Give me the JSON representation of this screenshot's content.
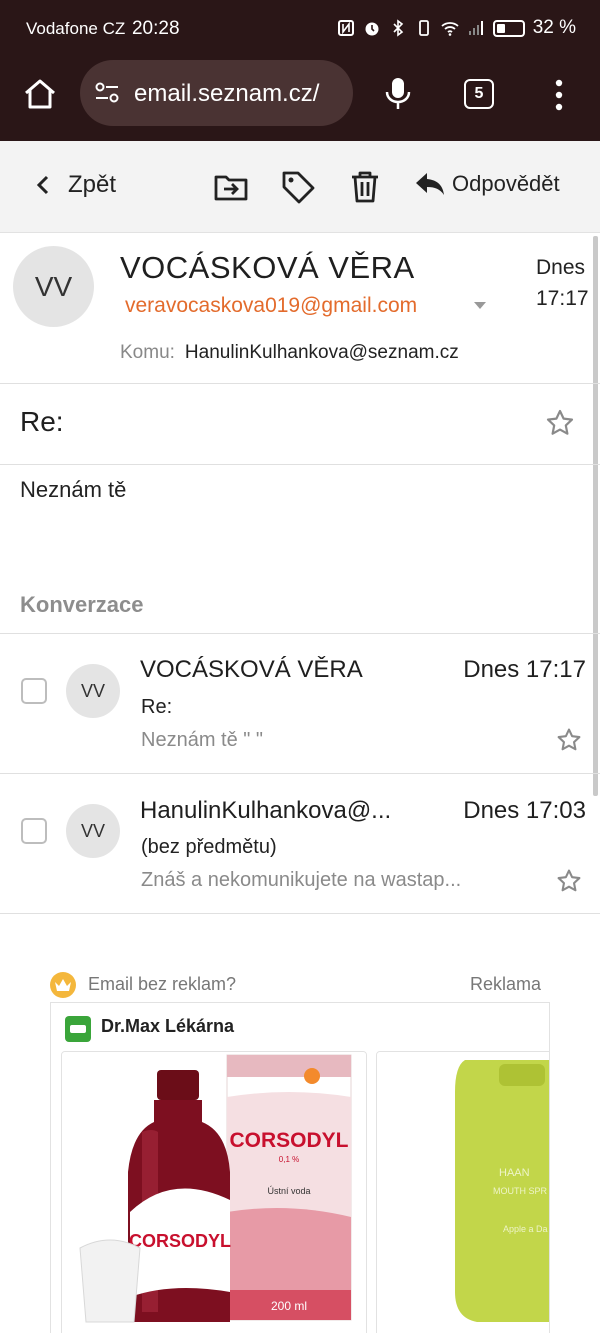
{
  "status_bar": {
    "carrier": "Vodafone CZ",
    "time": "20:28",
    "battery": "32 %"
  },
  "browser": {
    "url": "email.seznam.cz/",
    "tab_count": "5"
  },
  "toolbar": {
    "back_label": "Zpět",
    "reply_label": "Odpovědět"
  },
  "message": {
    "avatar_initials": "VV",
    "sender_name": "VOCÁSKOVÁ VĚRA",
    "sender_email": "veravocaskova019@gmail.com",
    "date_line1": "Dnes",
    "date_line2": "17:17",
    "to_label": "Komu:",
    "to_address": "HanulinKulhankova@seznam.cz",
    "subject": "Re:",
    "body": "Neznám tě"
  },
  "conversation": {
    "title": "Konverzace",
    "items": [
      {
        "initials": "VV",
        "from": "VOCÁSKOVÁ VĚRA",
        "date": "Dnes 17:17",
        "subject": "Re:",
        "snippet": "Neznám tě \" \""
      },
      {
        "initials": "VV",
        "from": "HanulinKulhankova@...",
        "date": "Dnes 17:03",
        "subject": "(bez předmětu)",
        "snippet": "Znáš a nekomunikujete na wastap..."
      }
    ]
  },
  "ad": {
    "no_ads_label": "Email bez reklam?",
    "ad_label": "Reklama",
    "brand": "Dr.Max Lékárna",
    "product1": {
      "brand": "CORSODYL",
      "strength": "0,1 %",
      "type": "Ústní voda",
      "volume": "200 ml"
    },
    "product2": {
      "brand": "HAAN",
      "line": "MOUTH SPR",
      "flavor": "Apple a Da"
    }
  },
  "colors": {
    "chrome_bg": "#2a1617",
    "email_accent": "#e36b2c",
    "corsodyl_red": "#c8102e"
  }
}
